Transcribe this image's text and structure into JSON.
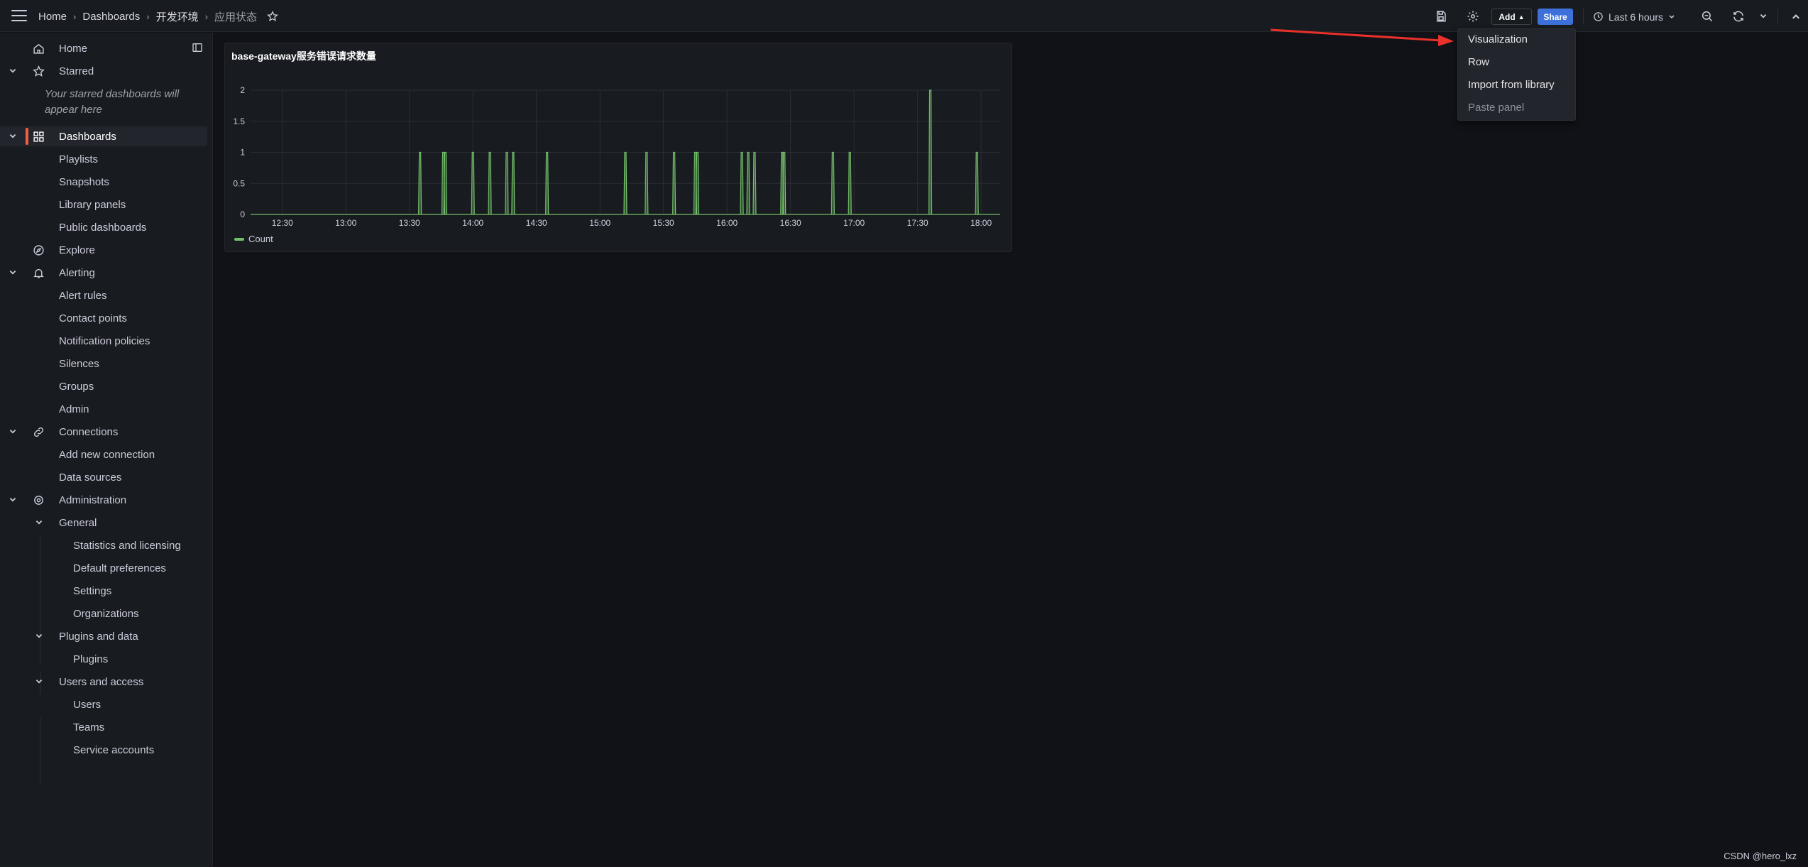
{
  "breadcrumb": {
    "items": [
      "Home",
      "Dashboards",
      "开发环境",
      "应用状态"
    ]
  },
  "toolbar": {
    "add_label": "Add",
    "share_label": "Share",
    "time_range": "Last 6 hours"
  },
  "sidebar": {
    "starred_hint": "Your starred dashboards will appear here",
    "items": [
      {
        "label": "Home",
        "icon": "home-icon"
      },
      {
        "label": "Starred",
        "icon": "star-icon"
      },
      {
        "label": "Dashboards",
        "icon": "apps-icon"
      },
      {
        "label": "Playlists"
      },
      {
        "label": "Snapshots"
      },
      {
        "label": "Library panels"
      },
      {
        "label": "Public dashboards"
      },
      {
        "label": "Explore",
        "icon": "compass-icon"
      },
      {
        "label": "Alerting",
        "icon": "bell-icon"
      },
      {
        "label": "Alert rules"
      },
      {
        "label": "Contact points"
      },
      {
        "label": "Notification policies"
      },
      {
        "label": "Silences"
      },
      {
        "label": "Groups"
      },
      {
        "label": "Admin"
      },
      {
        "label": "Connections",
        "icon": "link-icon"
      },
      {
        "label": "Add new connection"
      },
      {
        "label": "Data sources"
      },
      {
        "label": "Administration",
        "icon": "cog-icon"
      },
      {
        "label": "General"
      },
      {
        "label": "Statistics and licensing"
      },
      {
        "label": "Default preferences"
      },
      {
        "label": "Settings"
      },
      {
        "label": "Organizations"
      },
      {
        "label": "Plugins and data"
      },
      {
        "label": "Plugins"
      },
      {
        "label": "Users and access"
      },
      {
        "label": "Users"
      },
      {
        "label": "Teams"
      },
      {
        "label": "Service accounts"
      }
    ]
  },
  "panel": {
    "title": "base-gateway服务错误请求数量"
  },
  "chart_data": {
    "type": "bar",
    "title": "base-gateway服务错误请求数量",
    "x_ticks": [
      "12:30",
      "13:00",
      "13:30",
      "14:00",
      "14:30",
      "15:00",
      "15:30",
      "16:00",
      "16:30",
      "17:00",
      "17:30",
      "18:00"
    ],
    "y_ticks": [
      "0",
      "0.5",
      "1",
      "1.5",
      "2"
    ],
    "ylim": [
      0,
      2
    ],
    "xlim": [
      "12:15",
      "18:09"
    ],
    "grid": true,
    "legend_position": "bottom-left",
    "series": [
      {
        "name": "Count",
        "color": "#73bf69",
        "points": [
          {
            "t": "13:35",
            "v": 1
          },
          {
            "t": "13:46",
            "v": 1
          },
          {
            "t": "13:47",
            "v": 1
          },
          {
            "t": "14:00",
            "v": 1
          },
          {
            "t": "14:08",
            "v": 1
          },
          {
            "t": "14:16",
            "v": 1
          },
          {
            "t": "14:19",
            "v": 1
          },
          {
            "t": "14:35",
            "v": 1
          },
          {
            "t": "15:12",
            "v": 1
          },
          {
            "t": "15:22",
            "v": 1
          },
          {
            "t": "15:35",
            "v": 1
          },
          {
            "t": "15:45",
            "v": 1
          },
          {
            "t": "15:46",
            "v": 1
          },
          {
            "t": "16:07",
            "v": 1
          },
          {
            "t": "16:10",
            "v": 1
          },
          {
            "t": "16:13",
            "v": 1
          },
          {
            "t": "16:26",
            "v": 1
          },
          {
            "t": "16:27",
            "v": 1
          },
          {
            "t": "16:50",
            "v": 1
          },
          {
            "t": "16:58",
            "v": 1
          },
          {
            "t": "17:36",
            "v": 2
          },
          {
            "t": "17:58",
            "v": 1
          }
        ]
      }
    ]
  },
  "menu": {
    "items": [
      "Visualization",
      "Row",
      "Import from library",
      "Paste panel"
    ]
  },
  "watermark": "CSDN @hero_lxz"
}
